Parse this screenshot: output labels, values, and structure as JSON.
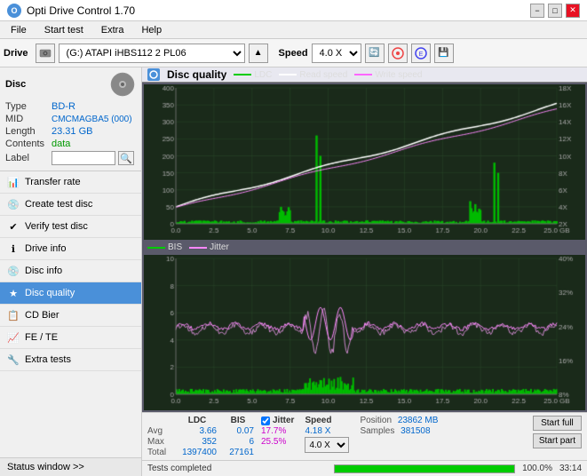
{
  "titleBar": {
    "title": "Opti Drive Control 1.70",
    "icon": "O",
    "minBtn": "−",
    "maxBtn": "□",
    "closeBtn": "✕"
  },
  "menuBar": {
    "items": [
      "File",
      "Start test",
      "Extra",
      "Help"
    ]
  },
  "toolbar": {
    "driveLabel": "Drive",
    "driveValue": "(G:) ATAPI iHBS112 2 PL06",
    "speedLabel": "Speed",
    "speedValue": "4.0 X"
  },
  "disc": {
    "header": "Disc",
    "typeLabel": "Type",
    "typeValue": "BD-R",
    "midLabel": "MID",
    "midValue": "CMCMAGBA5 (000)",
    "lengthLabel": "Length",
    "lengthValue": "23.31 GB",
    "contentsLabel": "Contents",
    "contentsValue": "data",
    "labelLabel": "Label",
    "labelValue": ""
  },
  "nav": {
    "items": [
      {
        "id": "transfer-rate",
        "label": "Transfer rate",
        "icon": "📊"
      },
      {
        "id": "create-test-disc",
        "label": "Create test disc",
        "icon": "💿"
      },
      {
        "id": "verify-test-disc",
        "label": "Verify test disc",
        "icon": "✔"
      },
      {
        "id": "drive-info",
        "label": "Drive info",
        "icon": "ℹ"
      },
      {
        "id": "disc-info",
        "label": "Disc info",
        "icon": "💿"
      },
      {
        "id": "disc-quality",
        "label": "Disc quality",
        "icon": "★",
        "active": true
      },
      {
        "id": "cd-bier",
        "label": "CD Bier",
        "icon": "📋"
      },
      {
        "id": "fe-te",
        "label": "FE / TE",
        "icon": "📈"
      },
      {
        "id": "extra-tests",
        "label": "Extra tests",
        "icon": "🔧"
      }
    ]
  },
  "statusWindow": {
    "label": "Status window >>"
  },
  "chart1": {
    "title": "Disc quality",
    "legends": [
      {
        "label": "LDC",
        "color": "#00cc00"
      },
      {
        "label": "Read speed",
        "color": "#ffffff"
      },
      {
        "label": "Write speed",
        "color": "#ff66ff"
      }
    ],
    "yMax": 400,
    "yAxisRight": [
      "18X",
      "16X",
      "14X",
      "12X",
      "10X",
      "8X",
      "6X",
      "4X",
      "2X"
    ],
    "xAxis": [
      "0.0",
      "2.5",
      "5.0",
      "7.5",
      "10.0",
      "12.5",
      "15.0",
      "17.5",
      "20.0",
      "22.5",
      "25.0 GB"
    ]
  },
  "chart2": {
    "title": "",
    "legends": [
      {
        "label": "BIS",
        "color": "#00cc00"
      },
      {
        "label": "Jitter",
        "color": "#ffffff"
      }
    ],
    "yMax": 10,
    "yAxisRight": [
      "40%",
      "32%",
      "24%",
      "16%",
      "8%"
    ],
    "xAxis": [
      "0.0",
      "2.5",
      "5.0",
      "7.5",
      "10.0",
      "12.5",
      "15.0",
      "17.5",
      "20.0",
      "22.5",
      "25.0 GB"
    ]
  },
  "stats": {
    "headers": {
      "ldc": "LDC",
      "bis": "BIS",
      "jitter": "Jitter",
      "speed": "Speed",
      "position": "Position",
      "samples": "Samples"
    },
    "avg": {
      "label": "Avg",
      "ldc": "3.66",
      "bis": "0.07",
      "jitter": "17.7%"
    },
    "max": {
      "label": "Max",
      "ldc": "352",
      "bis": "6",
      "jitter": "25.5%"
    },
    "total": {
      "label": "Total",
      "ldc": "1397400",
      "bis": "27161",
      "jitter": ""
    },
    "speedVal": "4.18 X",
    "speedSelect": "4.0 X",
    "position": "23862 MB",
    "samples": "381508",
    "startFull": "Start full",
    "startPart": "Start part"
  },
  "progressBar": {
    "statusText": "Tests completed",
    "percent": 100.0,
    "percentLabel": "100.0%",
    "time": "33:14"
  }
}
